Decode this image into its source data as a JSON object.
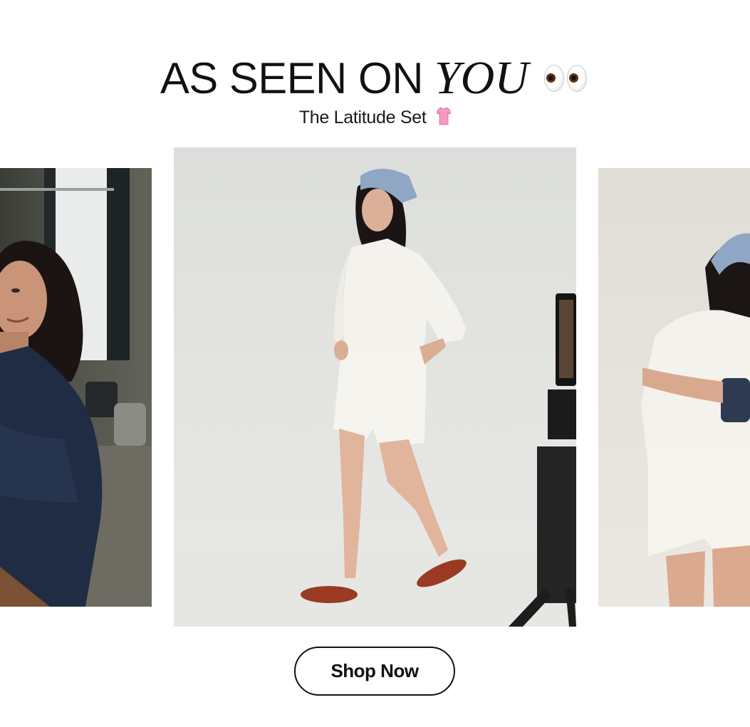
{
  "headline": {
    "lead": "AS SEEN ON",
    "accent": "YOU",
    "emoji": "eyes-icon"
  },
  "subtitle": {
    "text": "The Latitude Set",
    "emoji": "tshirt-icon"
  },
  "gallery": {
    "photos": [
      {
        "name": "photo-left",
        "subject": "woman in navy shirt"
      },
      {
        "name": "photo-center",
        "subject": "woman in white shirt and shorts"
      },
      {
        "name": "photo-right",
        "subject": "woman in white set with bandana"
      }
    ]
  },
  "cta": {
    "label": "Shop Now"
  },
  "colors": {
    "text": "#111111",
    "background": "#ffffff",
    "navy": "#1f2c44",
    "cream": "#f4f2ec",
    "bandana": "#8fa6c4",
    "shoe": "#9a3a22"
  }
}
